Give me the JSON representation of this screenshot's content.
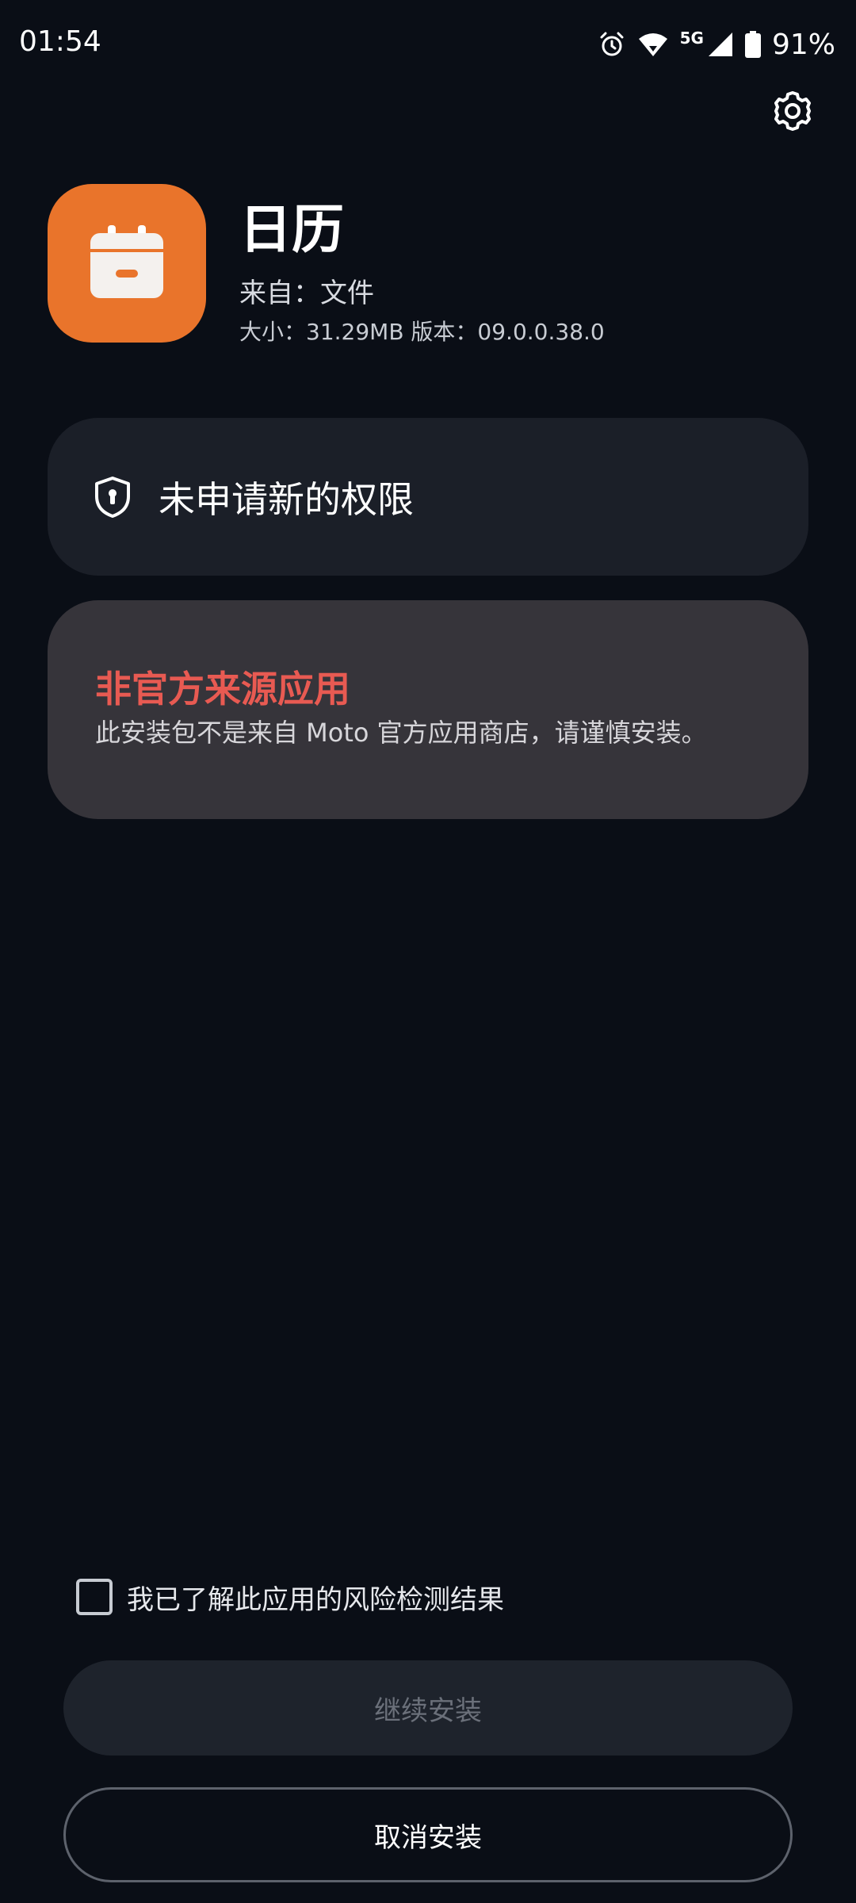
{
  "status_bar": {
    "time": "01:54",
    "network": "5G",
    "battery": "91%",
    "icons": [
      "alarm-icon",
      "wifi-icon",
      "signal-icon",
      "battery-icon"
    ]
  },
  "header": {
    "settings_icon": "gear-icon"
  },
  "app": {
    "name": "日历",
    "source": "来自：文件",
    "meta": "大小：31.29MB  版本：09.0.0.38.0",
    "icon": "calendar-icon",
    "icon_color": "#e9742b"
  },
  "permissions": {
    "text": "未申请新的权限",
    "icon": "shield-lock-icon"
  },
  "warning": {
    "title": "非官方来源应用",
    "description": "此安装包不是来自 Moto 官方应用商店，请谨慎安装。",
    "title_color": "#e85a52"
  },
  "acknowledge": {
    "label": "我已了解此应用的风险检测结果",
    "checked": false
  },
  "buttons": {
    "continue": "继续安装",
    "cancel": "取消安装"
  }
}
